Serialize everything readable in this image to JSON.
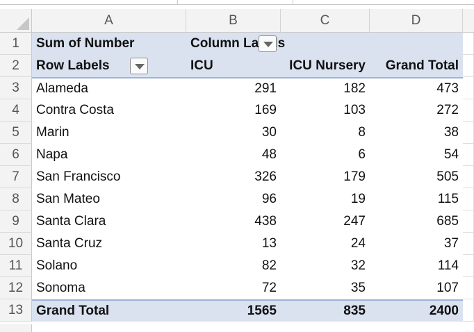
{
  "columns": [
    "A",
    "B",
    "C",
    "D"
  ],
  "row_numbers": [
    "1",
    "2",
    "3",
    "4",
    "5",
    "6",
    "7",
    "8",
    "9",
    "10",
    "11",
    "12",
    "13"
  ],
  "pivot": {
    "sum_label": "Sum of Number",
    "column_labels": "Column Labels",
    "row_labels": "Row Labels",
    "headers": [
      "ICU",
      "ICU Nursery",
      "Grand Total"
    ],
    "rows": [
      {
        "label": "Alameda",
        "icu": "291",
        "nursery": "182",
        "total": "473"
      },
      {
        "label": "Contra Costa",
        "icu": "169",
        "nursery": "103",
        "total": "272"
      },
      {
        "label": "Marin",
        "icu": "30",
        "nursery": "8",
        "total": "38"
      },
      {
        "label": "Napa",
        "icu": "48",
        "nursery": "6",
        "total": "54"
      },
      {
        "label": "San Francisco",
        "icu": "326",
        "nursery": "179",
        "total": "505"
      },
      {
        "label": "San Mateo",
        "icu": "96",
        "nursery": "19",
        "total": "115"
      },
      {
        "label": "Santa Clara",
        "icu": "438",
        "nursery": "247",
        "total": "685"
      },
      {
        "label": "Santa Cruz",
        "icu": "13",
        "nursery": "24",
        "total": "37"
      },
      {
        "label": "Solano",
        "icu": "82",
        "nursery": "32",
        "total": "114"
      },
      {
        "label": "Sonoma",
        "icu": "72",
        "nursery": "35",
        "total": "107"
      }
    ],
    "grand_total": {
      "label": "Grand Total",
      "icu": "1565",
      "nursery": "835",
      "total": "2400"
    }
  },
  "colors": {
    "pivot_header_bg": "#dae2f0",
    "pivot_border": "#9cb2d8",
    "header_bg": "#f3f3f3"
  },
  "icons": {
    "filter_dropdown": "chevron-down-icon",
    "select_all": "select-all-triangle-icon"
  }
}
